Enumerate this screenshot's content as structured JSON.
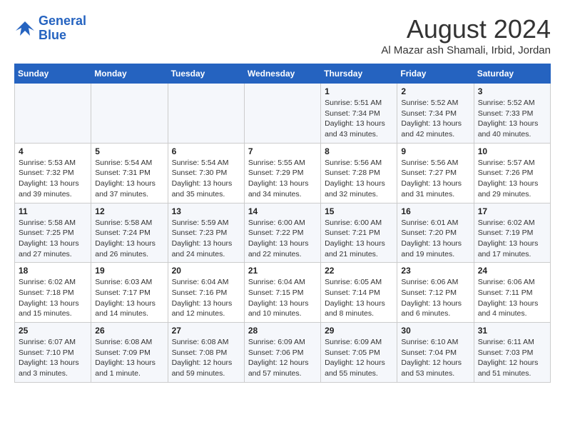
{
  "header": {
    "logo_line1": "General",
    "logo_line2": "Blue",
    "month_title": "August 2024",
    "location": "Al Mazar ash Shamali, Irbid, Jordan"
  },
  "days_of_week": [
    "Sunday",
    "Monday",
    "Tuesday",
    "Wednesday",
    "Thursday",
    "Friday",
    "Saturday"
  ],
  "weeks": [
    [
      {
        "day": "",
        "info": ""
      },
      {
        "day": "",
        "info": ""
      },
      {
        "day": "",
        "info": ""
      },
      {
        "day": "",
        "info": ""
      },
      {
        "day": "1",
        "info": "Sunrise: 5:51 AM\nSunset: 7:34 PM\nDaylight: 13 hours\nand 43 minutes."
      },
      {
        "day": "2",
        "info": "Sunrise: 5:52 AM\nSunset: 7:34 PM\nDaylight: 13 hours\nand 42 minutes."
      },
      {
        "day": "3",
        "info": "Sunrise: 5:52 AM\nSunset: 7:33 PM\nDaylight: 13 hours\nand 40 minutes."
      }
    ],
    [
      {
        "day": "4",
        "info": "Sunrise: 5:53 AM\nSunset: 7:32 PM\nDaylight: 13 hours\nand 39 minutes."
      },
      {
        "day": "5",
        "info": "Sunrise: 5:54 AM\nSunset: 7:31 PM\nDaylight: 13 hours\nand 37 minutes."
      },
      {
        "day": "6",
        "info": "Sunrise: 5:54 AM\nSunset: 7:30 PM\nDaylight: 13 hours\nand 35 minutes."
      },
      {
        "day": "7",
        "info": "Sunrise: 5:55 AM\nSunset: 7:29 PM\nDaylight: 13 hours\nand 34 minutes."
      },
      {
        "day": "8",
        "info": "Sunrise: 5:56 AM\nSunset: 7:28 PM\nDaylight: 13 hours\nand 32 minutes."
      },
      {
        "day": "9",
        "info": "Sunrise: 5:56 AM\nSunset: 7:27 PM\nDaylight: 13 hours\nand 31 minutes."
      },
      {
        "day": "10",
        "info": "Sunrise: 5:57 AM\nSunset: 7:26 PM\nDaylight: 13 hours\nand 29 minutes."
      }
    ],
    [
      {
        "day": "11",
        "info": "Sunrise: 5:58 AM\nSunset: 7:25 PM\nDaylight: 13 hours\nand 27 minutes."
      },
      {
        "day": "12",
        "info": "Sunrise: 5:58 AM\nSunset: 7:24 PM\nDaylight: 13 hours\nand 26 minutes."
      },
      {
        "day": "13",
        "info": "Sunrise: 5:59 AM\nSunset: 7:23 PM\nDaylight: 13 hours\nand 24 minutes."
      },
      {
        "day": "14",
        "info": "Sunrise: 6:00 AM\nSunset: 7:22 PM\nDaylight: 13 hours\nand 22 minutes."
      },
      {
        "day": "15",
        "info": "Sunrise: 6:00 AM\nSunset: 7:21 PM\nDaylight: 13 hours\nand 21 minutes."
      },
      {
        "day": "16",
        "info": "Sunrise: 6:01 AM\nSunset: 7:20 PM\nDaylight: 13 hours\nand 19 minutes."
      },
      {
        "day": "17",
        "info": "Sunrise: 6:02 AM\nSunset: 7:19 PM\nDaylight: 13 hours\nand 17 minutes."
      }
    ],
    [
      {
        "day": "18",
        "info": "Sunrise: 6:02 AM\nSunset: 7:18 PM\nDaylight: 13 hours\nand 15 minutes."
      },
      {
        "day": "19",
        "info": "Sunrise: 6:03 AM\nSunset: 7:17 PM\nDaylight: 13 hours\nand 14 minutes."
      },
      {
        "day": "20",
        "info": "Sunrise: 6:04 AM\nSunset: 7:16 PM\nDaylight: 13 hours\nand 12 minutes."
      },
      {
        "day": "21",
        "info": "Sunrise: 6:04 AM\nSunset: 7:15 PM\nDaylight: 13 hours\nand 10 minutes."
      },
      {
        "day": "22",
        "info": "Sunrise: 6:05 AM\nSunset: 7:14 PM\nDaylight: 13 hours\nand 8 minutes."
      },
      {
        "day": "23",
        "info": "Sunrise: 6:06 AM\nSunset: 7:12 PM\nDaylight: 13 hours\nand 6 minutes."
      },
      {
        "day": "24",
        "info": "Sunrise: 6:06 AM\nSunset: 7:11 PM\nDaylight: 13 hours\nand 4 minutes."
      }
    ],
    [
      {
        "day": "25",
        "info": "Sunrise: 6:07 AM\nSunset: 7:10 PM\nDaylight: 13 hours\nand 3 minutes."
      },
      {
        "day": "26",
        "info": "Sunrise: 6:08 AM\nSunset: 7:09 PM\nDaylight: 13 hours\nand 1 minute."
      },
      {
        "day": "27",
        "info": "Sunrise: 6:08 AM\nSunset: 7:08 PM\nDaylight: 12 hours\nand 59 minutes."
      },
      {
        "day": "28",
        "info": "Sunrise: 6:09 AM\nSunset: 7:06 PM\nDaylight: 12 hours\nand 57 minutes."
      },
      {
        "day": "29",
        "info": "Sunrise: 6:09 AM\nSunset: 7:05 PM\nDaylight: 12 hours\nand 55 minutes."
      },
      {
        "day": "30",
        "info": "Sunrise: 6:10 AM\nSunset: 7:04 PM\nDaylight: 12 hours\nand 53 minutes."
      },
      {
        "day": "31",
        "info": "Sunrise: 6:11 AM\nSunset: 7:03 PM\nDaylight: 12 hours\nand 51 minutes."
      }
    ]
  ]
}
